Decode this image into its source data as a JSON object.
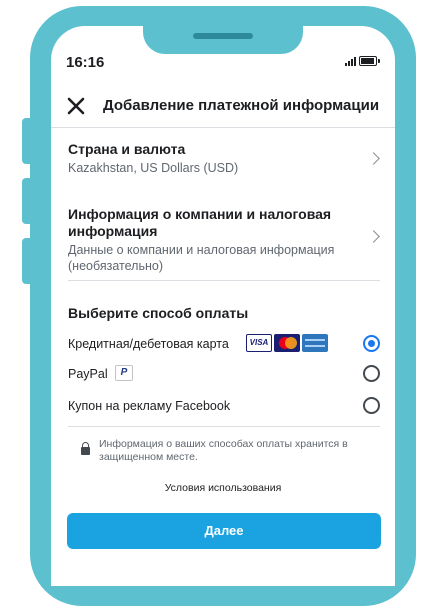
{
  "status": {
    "time": "16:16"
  },
  "header": {
    "title": "Добавление платежной информации"
  },
  "country": {
    "title": "Страна и валюта",
    "value": "Kazakhstan, US Dollars (USD)"
  },
  "company": {
    "title": "Информация о компании и налоговая информация",
    "subtitle": "Данные о компании и налоговая информация (необязательно)"
  },
  "payment": {
    "section_title": "Выберите способ оплаты",
    "options": [
      {
        "label": "Кредитная/дебетовая карта",
        "selected": true
      },
      {
        "label": "PayPal",
        "selected": false
      },
      {
        "label": "Купон на рекламу Facebook",
        "selected": false
      }
    ],
    "card_logos": [
      "VISA",
      "mastercard",
      "amex"
    ]
  },
  "secure_note": "Информация о ваших способах оплаты хранится в защищенном месте.",
  "terms_link": "Условия использования",
  "next_button": "Далее",
  "colors": {
    "frame": "#5cc0cf",
    "accent": "#1877f2",
    "button": "#1aa3e0"
  }
}
